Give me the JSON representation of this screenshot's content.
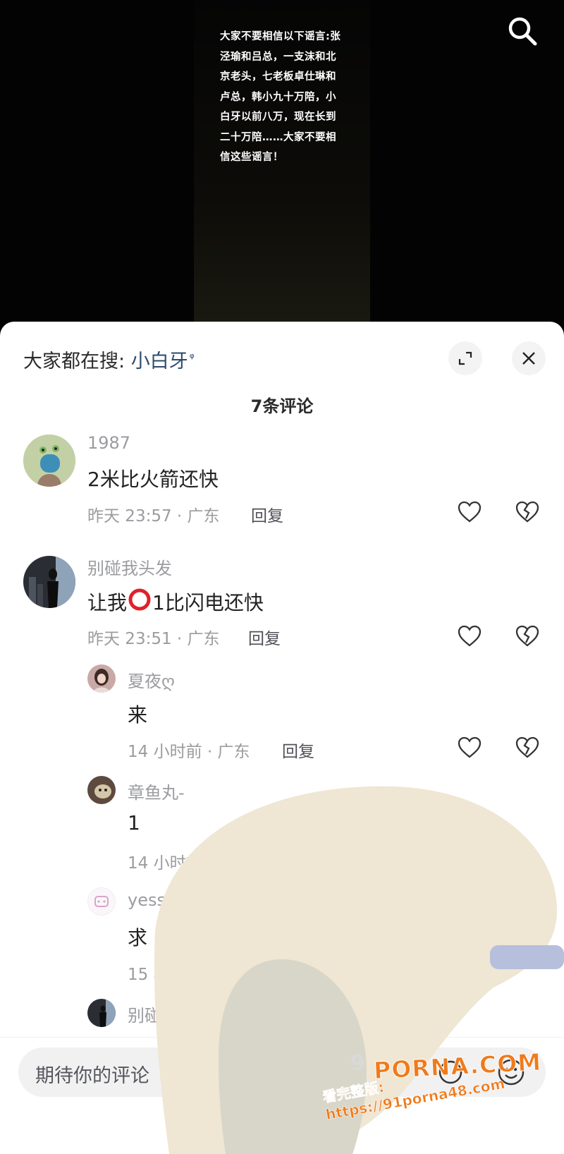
{
  "video": {
    "overlay_text": "大家不要相信以下谣言:张泾瑜和吕总，一支沫和北京老头，七老板卓仕琳和卢总，韩小九十万陪，小白牙以前八万，现在长到二十万陪……大家不要相信这些谣言！",
    "search_icon": "search-icon"
  },
  "sheet": {
    "hot_search_label": "大家都在搜: ",
    "hot_search_term": "小白牙",
    "expand_icon": "expand-icon",
    "close_icon": "close-icon",
    "comment_count_title": "7条评论"
  },
  "comments": [
    {
      "user": "1987",
      "text": "2米比火箭还快",
      "time_location": "昨天 23:57 · 广东",
      "reply_label": "回复"
    },
    {
      "user": "别碰我头发",
      "text_before": "让我",
      "text_emoji": "⭕",
      "text_after": "1比闪电还快",
      "time_location": "昨天 23:51 · 广东",
      "reply_label": "回复",
      "replies": [
        {
          "user": "夏夜ღ",
          "text": "来",
          "time_location": "14 小时前 · 广东",
          "reply_label": "回复"
        },
        {
          "user": "章鱼丸-",
          "text": "1",
          "time_location": "14 小时前"
        },
        {
          "user": "yesss",
          "text": "求",
          "time_location": "15 小"
        },
        {
          "user": "别碰我"
        }
      ]
    }
  ],
  "input": {
    "placeholder": "期待你的评论",
    "emoji_icon": "emoji-icon",
    "at_icon": "at-icon"
  },
  "watermark": {
    "brand": "PORNA.COM",
    "prefix": "9",
    "url_line": "看完整版: https://91porna48.com"
  },
  "colors": {
    "sheet_bg": "#ffffff",
    "video_bg": "#030303",
    "link_blue": "#2e4a6c",
    "meta_gray": "#9b9ca0",
    "watermark_orange": "#f07a1a"
  }
}
